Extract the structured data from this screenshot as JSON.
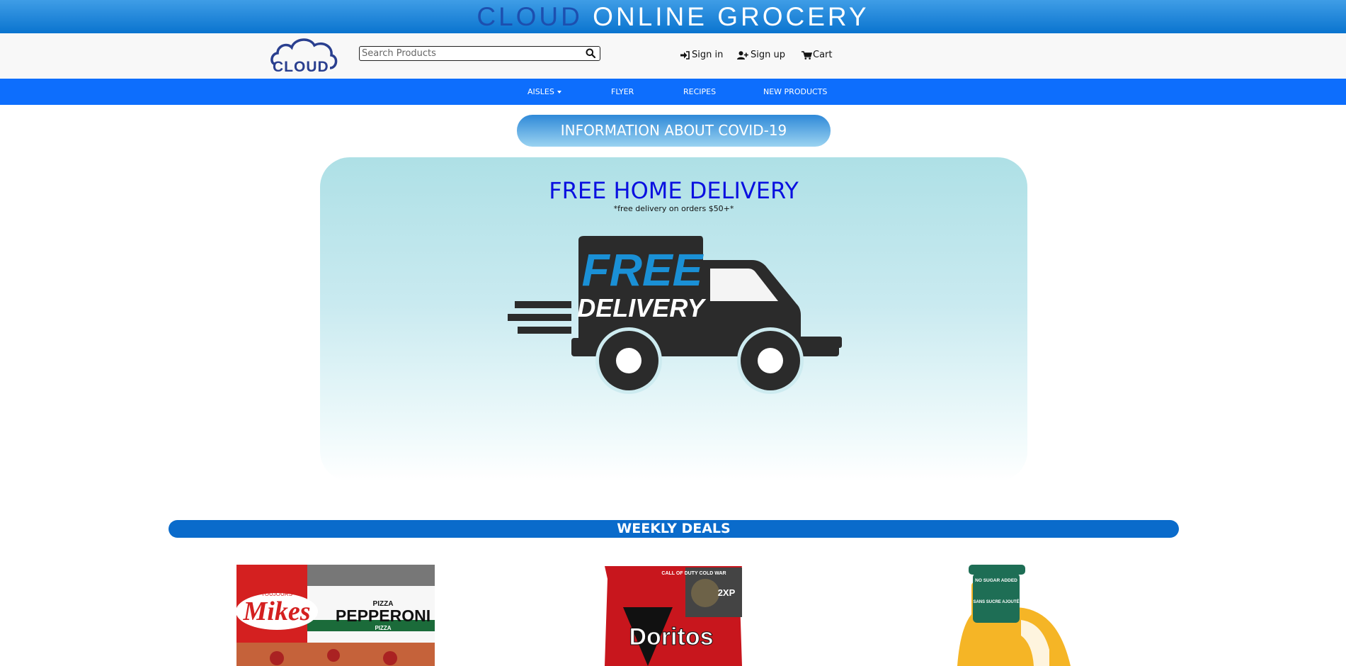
{
  "site_title": {
    "part1": "CLOUD",
    "part2": " ONLINE GROCERY"
  },
  "logo": {
    "text": "CLOUD"
  },
  "search": {
    "placeholder": "Search Products"
  },
  "header_links": {
    "sign_in": "Sign in",
    "sign_up": "Sign up",
    "cart": "Cart"
  },
  "nav": {
    "aisles": "AISLES",
    "flyer": "FLYER",
    "recipes": "RECIPES",
    "new_products": "NEW PRODUCTS"
  },
  "covid_button": "INFORMATION ABOUT COVID-19",
  "hero": {
    "title": "FREE HOME DELIVERY",
    "subtitle": "*free delivery on orders $50+*",
    "truck_text_1": "FREE",
    "truck_text_2": "DELIVERY"
  },
  "weekly_deals": "WEEKLY DEALS",
  "products": [
    {
      "brand": "Mikes",
      "tag": "TOUJOURS",
      "line1": "PIZZA",
      "line2": "PEPPERONI",
      "line3": "PIZZA"
    },
    {
      "brand": "Doritos",
      "tag": "CALL OF DUTY COLD WAR",
      "badge": "2XP"
    },
    {
      "label1": "NO SUGAR ADDED",
      "label2": "SANS SUCRE AJOUTÉ"
    }
  ],
  "colors": {
    "primary_blue": "#0d6efd",
    "title_bar": "#0a74cf",
    "hero_title": "#0a10e0",
    "deals_bar": "#0a6bcb"
  }
}
